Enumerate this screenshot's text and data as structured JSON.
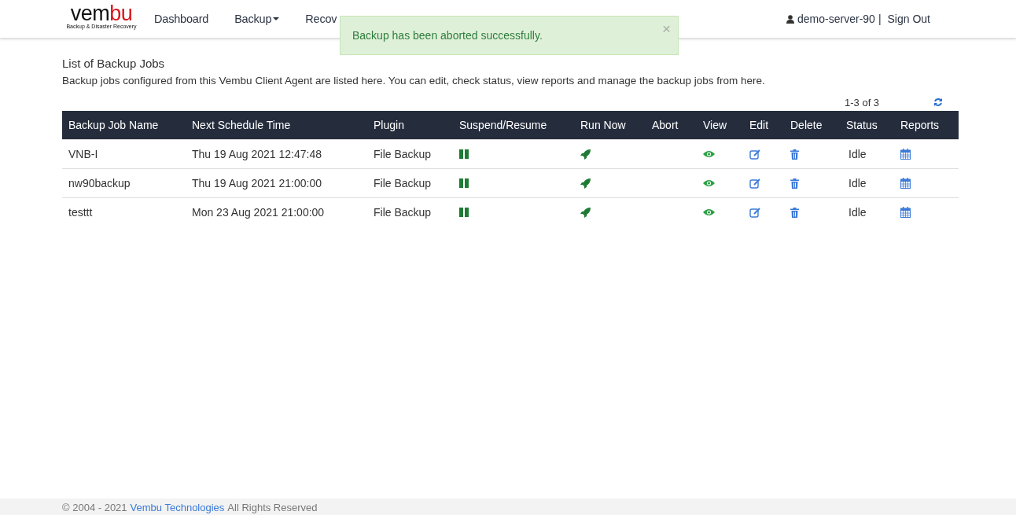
{
  "logo": {
    "word_start": "vem",
    "word_end": "bu",
    "tagline": "Backup & Disaster Recovery"
  },
  "nav": [
    {
      "label": "Dashboard",
      "dropdown": false
    },
    {
      "label": "Backup",
      "dropdown": true
    },
    {
      "label": "Recov",
      "dropdown": false
    }
  ],
  "user": {
    "name": "demo-server-90",
    "separator": "|",
    "sign_out": "Sign Out"
  },
  "alert": {
    "message": "Backup has been aborted successfully.",
    "close": "×"
  },
  "page": {
    "title": "List of Backup Jobs",
    "description": "Backup jobs configured from this Vembu Client Agent are listed here. You can edit, check status, view reports and manage the backup jobs from here.",
    "pagination": "1-3 of 3"
  },
  "table": {
    "columns": [
      "Backup Job Name",
      "Next Schedule Time",
      "Plugin",
      "Suspend/Resume",
      "Run Now",
      "Abort",
      "View",
      "Edit",
      "Delete",
      "Status",
      "Reports"
    ],
    "rows": [
      {
        "name": "VNB-I",
        "next_schedule": "Thu 19 Aug 2021 12:47:48",
        "plugin": "File Backup",
        "status": "Idle"
      },
      {
        "name": "nw90backup",
        "next_schedule": "Thu 19 Aug 2021 21:00:00",
        "plugin": "File Backup",
        "status": "Idle"
      },
      {
        "name": "testtt",
        "next_schedule": "Mon 23 Aug 2021 21:00:00",
        "plugin": "File Backup",
        "status": "Idle"
      }
    ]
  },
  "footer": {
    "copyright": "© 2004 - 2021",
    "company_link": "Vembu Technologies",
    "rights": "All Rights Reserved"
  }
}
